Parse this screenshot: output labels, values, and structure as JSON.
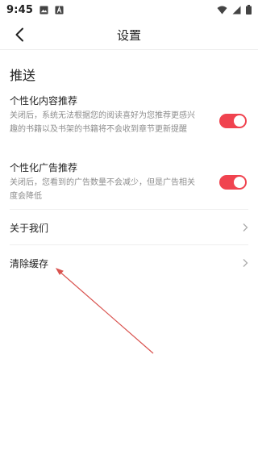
{
  "status_bar": {
    "time": "9:45",
    "left_icons": [
      "image-icon",
      "text-icon"
    ],
    "right_icons": [
      "wifi-icon",
      "signal-icon",
      "battery-icon"
    ]
  },
  "header": {
    "title": "设置",
    "back_icon": "back-arrow-icon"
  },
  "section": {
    "title": "推送"
  },
  "settings": [
    {
      "title": "个性化内容推荐",
      "description": "关闭后，系统无法根据您的阅读喜好为您推荐更感兴趣的书籍以及书架的书籍将不会收到章节更新提醒",
      "enabled": true
    },
    {
      "title": "个性化广告推荐",
      "description": "关闭后，您看到的广告数量不会减少，但是广告相关度会降低",
      "enabled": true
    }
  ],
  "links": [
    {
      "label": "关于我们",
      "icon": "chevron-right-icon"
    },
    {
      "label": "清除缓存",
      "icon": "chevron-right-icon"
    }
  ],
  "colors": {
    "accent": "#f0434f",
    "annotation_arrow": "#d9534f"
  }
}
